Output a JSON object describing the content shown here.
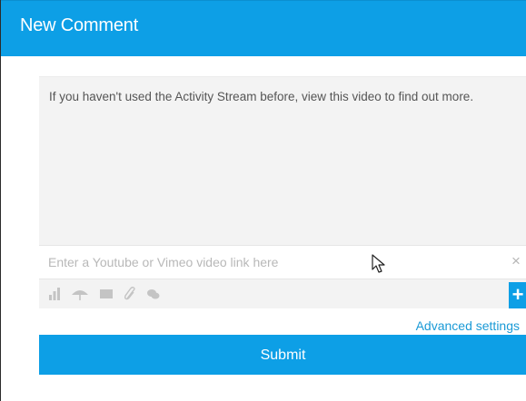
{
  "dialog": {
    "title": "New Comment"
  },
  "composer": {
    "comment_text": "If you haven't used the Activity Stream before, view this video to find out more.",
    "video_link": {
      "placeholder": "Enter a Youtube or Vimeo video link here",
      "value": "",
      "clear_glyph": "×"
    },
    "toolbar": {
      "icons": [
        "bar-chart-icon",
        "umbrella-icon",
        "image-icon",
        "link-icon",
        "chat-icon"
      ],
      "add_glyph": "+"
    }
  },
  "advanced_settings_label": "Advanced settings",
  "submit_label": "Submit",
  "colors": {
    "accent": "#0d9fe6",
    "link": "#1a9ad6",
    "composer_bg": "#f3f3f3",
    "toolbar_icon": "#c4c4c4"
  }
}
